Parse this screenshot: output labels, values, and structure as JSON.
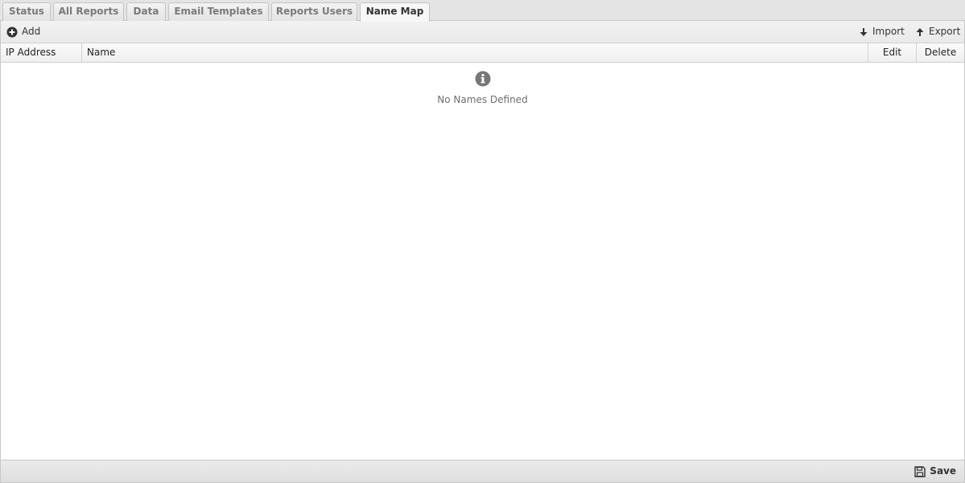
{
  "tabs": [
    {
      "label": "Status"
    },
    {
      "label": "All Reports"
    },
    {
      "label": "Data"
    },
    {
      "label": "Email Templates"
    },
    {
      "label": "Reports Users"
    },
    {
      "label": "Name Map",
      "active": true
    }
  ],
  "toolbar": {
    "add_label": "Add",
    "import_label": "Import",
    "export_label": "Export"
  },
  "grid": {
    "columns": [
      "IP Address",
      "Name",
      "Edit",
      "Delete"
    ],
    "empty_message": "No Names Defined"
  },
  "footer": {
    "save_label": "Save"
  },
  "icons": {
    "add": "plus-circle-icon",
    "import": "arrow-down-icon",
    "export": "arrow-up-icon",
    "info": "info-circle-icon",
    "save": "floppy-disk-icon"
  },
  "colors": {
    "tab_inactive_text": "#7a7a7a",
    "tab_active_text": "#333333",
    "icon_gray": "#777777",
    "empty_text": "#6e6e6e"
  }
}
